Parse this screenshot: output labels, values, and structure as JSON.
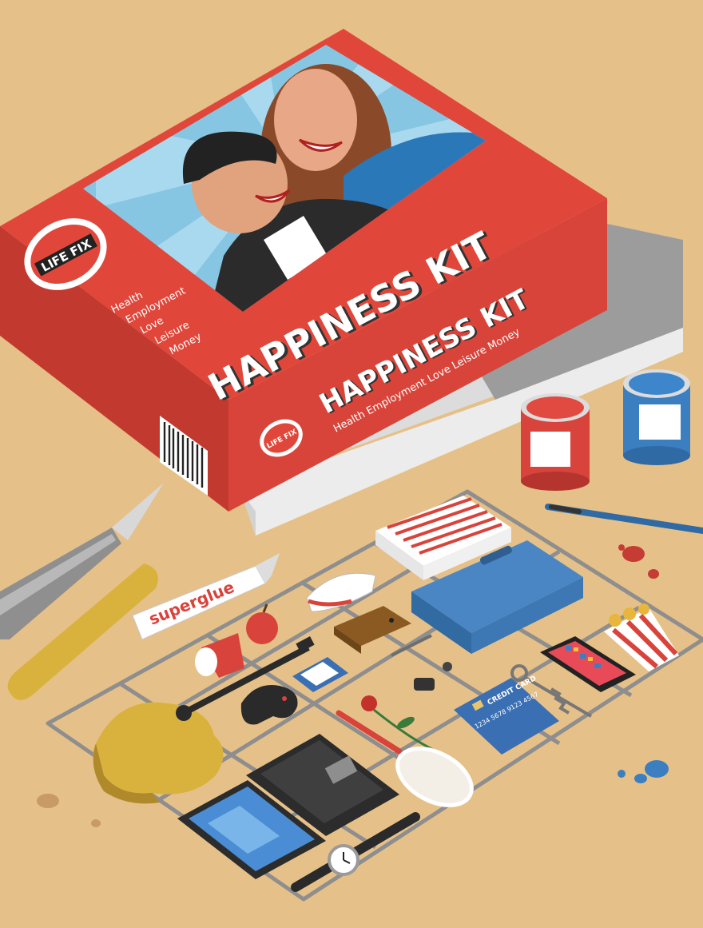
{
  "box": {
    "brand": "LIFE FIX",
    "title": "HAPPINESS KIT",
    "bullets": [
      "Health",
      "Employment",
      "Love",
      "Leisure",
      "Money"
    ],
    "side_title": "HAPPINESS KIT",
    "side_subtitle": "Health  Employment  Love  Leisure  Money"
  },
  "items": {
    "glue_label": "superglue",
    "card_title": "CREDIT CARD",
    "card_number": "1234  5678  9123  4567"
  },
  "colors": {
    "background": "#e6c089",
    "box_red": "#e0473a",
    "box_red_dark": "#c23a2f",
    "sky_blue": "#86c6e2",
    "sprue_grey": "#8e8e8e",
    "paint_blue": "#3c7fc0",
    "paint_red": "#d8433b"
  }
}
